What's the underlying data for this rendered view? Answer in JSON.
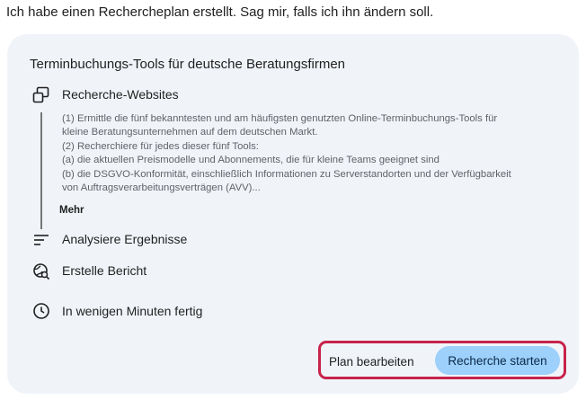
{
  "intro_text": "Ich habe einen Rechercheplan erstellt. Sag mir, falls ich ihn ändern soll.",
  "plan": {
    "title": "Terminbuchungs-Tools für deutsche Beratungsfirmen",
    "steps": [
      {
        "icon": "web-windows-icon",
        "label": "Recherche-Websites",
        "description_lines": [
          "(1) Ermittle die fünf bekanntesten und am häufigsten genutzten Online-Terminbuchungs-Tools für",
          "kleine Beratungsunternehmen auf dem deutschen Markt.",
          "(2) Recherchiere für jedes dieser fünf Tools:",
          "(a) die aktuellen Preismodelle und Abonnements, die für kleine Teams geeignet sind",
          "(b) die DSGVO-Konformität, einschließlich Informationen zu Serverstandorten und der Verfügbarkeit",
          "von Auftragsverarbeitungsverträgen (AVV)..."
        ],
        "more_label": "Mehr"
      },
      {
        "icon": "sort-lines-icon",
        "label": "Analysiere Ergebnisse"
      },
      {
        "icon": "globe-search-icon",
        "label": "Erstelle Bericht"
      }
    ],
    "eta": {
      "icon": "clock-icon",
      "label": "In wenigen Minuten fertig"
    }
  },
  "actions": {
    "edit_label": "Plan bearbeiten",
    "start_label": "Recherche starten"
  },
  "colors": {
    "card_background": "#f0f4f9",
    "primary_button": "#9dd0fb",
    "highlight_border": "#c8234a"
  }
}
